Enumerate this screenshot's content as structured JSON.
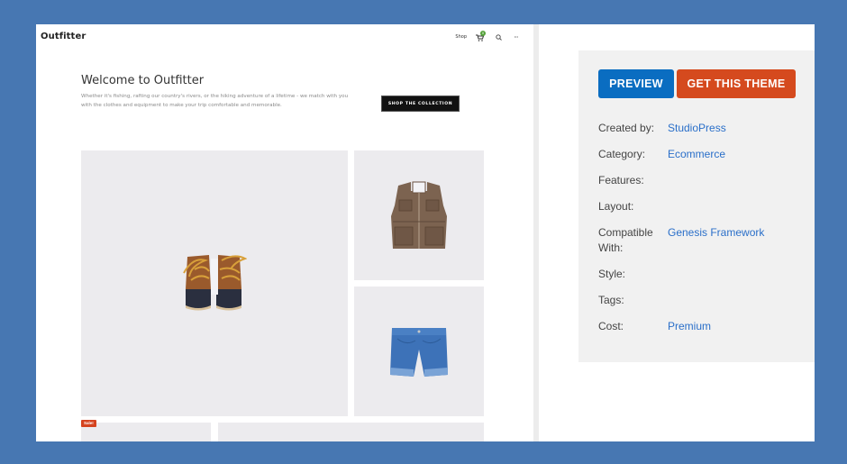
{
  "site": {
    "logo": "Outfitter",
    "nav": {
      "shop_label": "Shop",
      "cart_count": "0",
      "search_icon": "search-icon",
      "more_icon": "more-icon",
      "more_glyph": "•••"
    },
    "hero": {
      "title": "Welcome to Outfitter",
      "text": "Whether it's fishing, rafting our country's rivers, or the hiking adventure of a lifetime - we match with you with the clothes and equipment to make your trip comfortable and memorable.",
      "button_label": "SHOP THE COLLECTION"
    },
    "products": [
      {
        "name": "Boots"
      },
      {
        "name": "Vest"
      },
      {
        "name": "Denim Shorts"
      }
    ],
    "sale_badge": "Sale!"
  },
  "panel": {
    "preview_label": "PREVIEW",
    "get_theme_label": "GET THIS THEME",
    "meta": [
      {
        "label": "Created by:",
        "value": "StudioPress"
      },
      {
        "label": "Category:",
        "value": "Ecommerce"
      },
      {
        "label": "Features:",
        "value": ""
      },
      {
        "label": "Layout:",
        "value": ""
      },
      {
        "label": "Compatible With:",
        "value": "Genesis Framework"
      },
      {
        "label": "Style:",
        "value": ""
      },
      {
        "label": "Tags:",
        "value": ""
      },
      {
        "label": "Cost:",
        "value": "Premium"
      }
    ]
  },
  "colors": {
    "background": "#4777b2",
    "preview_button": "#0a6dc1",
    "get_theme_button": "#d54a1e",
    "link": "#2a6fc9",
    "sale_badge": "#d5431f",
    "cart_badge": "#56a23c"
  }
}
